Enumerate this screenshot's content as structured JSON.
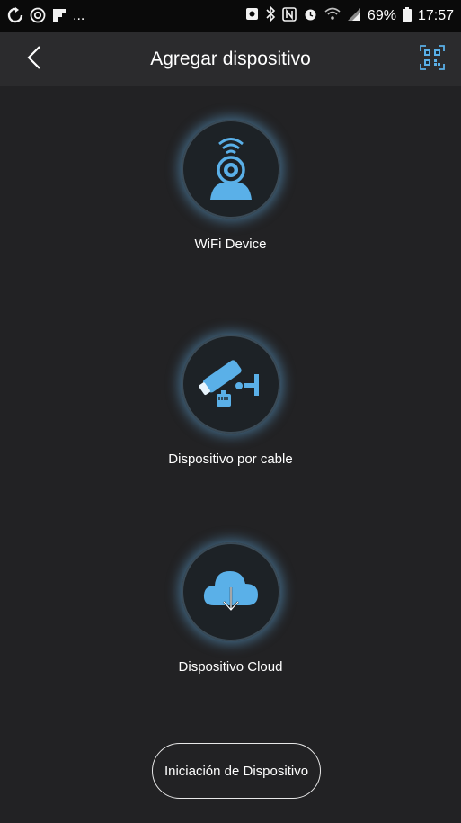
{
  "status_bar": {
    "left_icons": [
      "sync-icon",
      "instagram-icon",
      "flipboard-icon",
      "more-notifications-icon"
    ],
    "more_text": "...",
    "right_icons": [
      "gallery-icon",
      "bluetooth-icon",
      "nfc-icon",
      "alarm-icon",
      "wifi-icon",
      "signal-icon",
      "battery-icon"
    ],
    "battery": "69%",
    "time": "17:57"
  },
  "app_bar": {
    "title": "Agregar dispositivo",
    "back_icon": "chevron-left-icon",
    "qr_icon": "qr-code-scan-icon"
  },
  "options": [
    {
      "label": "WiFi Device",
      "icon": "wifi-camera-icon"
    },
    {
      "label": "Dispositivo por cable",
      "icon": "wired-camera-icon"
    },
    {
      "label": "Dispositivo Cloud",
      "icon": "cloud-download-icon"
    }
  ],
  "bottom_button": {
    "label": "Iniciación de Dispositivo"
  },
  "colors": {
    "accent": "#5ab0e8",
    "background": "#222224",
    "app_bar": "#2b2b2d"
  }
}
